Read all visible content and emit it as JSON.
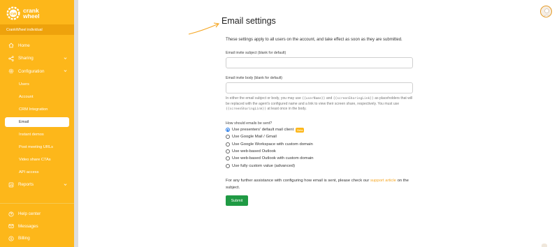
{
  "brand": {
    "line1": "crank",
    "line2": "wheel"
  },
  "account": {
    "name": "CrankWheel individual"
  },
  "sidebar": {
    "items": [
      {
        "label": "Home",
        "icon": "home-icon"
      },
      {
        "label": "Sharing",
        "icon": "share-icon"
      },
      {
        "label": "Configuration",
        "icon": "gear-icon"
      }
    ],
    "sub_items": [
      {
        "label": "Users"
      },
      {
        "label": "Account"
      },
      {
        "label": "CRM Integration"
      },
      {
        "label": "Email"
      },
      {
        "label": "Instant demos"
      },
      {
        "label": "Post meeting URLs"
      },
      {
        "label": "Video share CTAs"
      },
      {
        "label": "API access"
      }
    ],
    "reports": {
      "label": "Reports",
      "icon": "chart-icon"
    },
    "bottom": [
      {
        "label": "Help center",
        "icon": "help-icon"
      },
      {
        "label": "Messages",
        "icon": "mail-icon"
      },
      {
        "label": "Billing",
        "icon": "dollar-icon"
      }
    ],
    "active_sub": "Email"
  },
  "main": {
    "title": "Email settings",
    "intro": "These settings apply to all users on the account, and take effect as soon as they are submitted.",
    "subject_label": "Email invite subject (blank for default)",
    "subject_value": "",
    "body_label": "Email invite body (blank for default)",
    "body_value": "",
    "help_p1": "In either the email subject or body, you may use ",
    "help_code1": "{{userName}}",
    "help_p2": " and ",
    "help_code2": "{{screenSharingLink}}",
    "help_p3": " as placeholders that will be replaced with the agent's configured name and a link to view their screen share, respectively. You must use ",
    "help_code3": "{{screenSharingLink}}",
    "help_p4": " at least once in the body.",
    "question": "How should emails be sent?",
    "options": [
      {
        "label": "Use presenters' default mail client",
        "badge": "Beta"
      },
      {
        "label": "Use Google Mail / Gmail"
      },
      {
        "label": "Use Google Workspace with custom domain"
      },
      {
        "label": "Use web-based Outlook"
      },
      {
        "label": "Use web-based Outlook with custom domain"
      },
      {
        "label": "Use fully custom value (advanced)"
      }
    ],
    "assist_p1": "For any further assistance with configuring how email is sent, please check our ",
    "assist_link": "support article",
    "assist_p2": " on the subject.",
    "submit_label": "Submit"
  },
  "colors": {
    "sidebar": "#fdb71a",
    "accent": "#f5a623",
    "submit": "#1f9a44"
  }
}
